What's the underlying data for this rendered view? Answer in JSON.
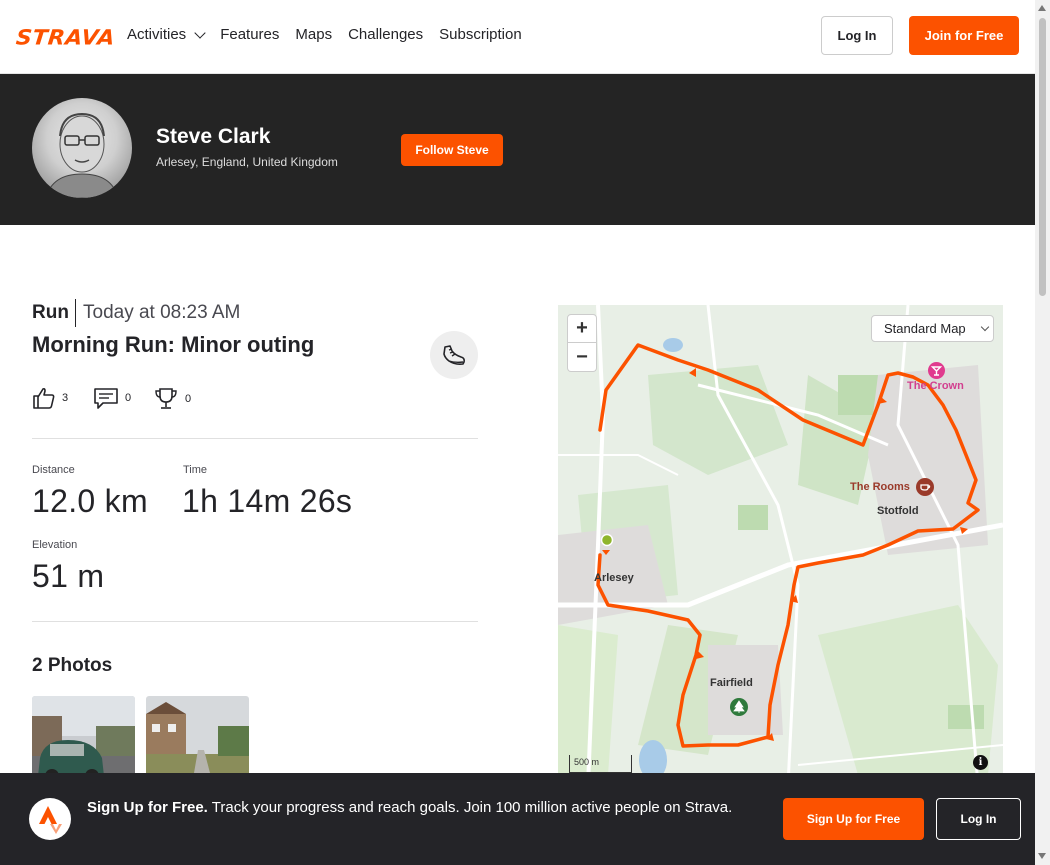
{
  "nav": {
    "logo": "STRAVA",
    "links": [
      "Activities",
      "Features",
      "Maps",
      "Challenges",
      "Subscription"
    ],
    "login": "Log In",
    "join": "Join for Free"
  },
  "athlete": {
    "name": "Steve Clark",
    "location": "Arlesey, England, United Kingdom",
    "follow": "Follow Steve"
  },
  "activity": {
    "type": "Run",
    "time": "Today at 08:23 AM",
    "title": "Morning Run: Minor outing",
    "kudos": "3",
    "comments": "0",
    "achievements": "0",
    "stats": [
      {
        "label": "Distance",
        "value": "12.0 km"
      },
      {
        "label": "Time",
        "value": "1h 14m 26s"
      },
      {
        "label": "Elevation",
        "value": "51 m"
      }
    ],
    "photos_title": "2 Photos"
  },
  "map": {
    "style": "Standard Map",
    "zoom_in": "+",
    "zoom_out": "−",
    "scale": "500 m",
    "places": [
      "Arlesey",
      "Stotfold",
      "Fairfield"
    ],
    "pois": [
      "The Crown",
      "The Rooms"
    ],
    "route_color": "#fc5200"
  },
  "banner": {
    "headline": "Sign Up for Free.",
    "text": "Track your progress and reach goals. Join 100 million active people on Strava.",
    "signup": "Sign Up for Free",
    "login": "Log In"
  },
  "colors": {
    "brand": "#fc5200",
    "dark": "#242424"
  }
}
